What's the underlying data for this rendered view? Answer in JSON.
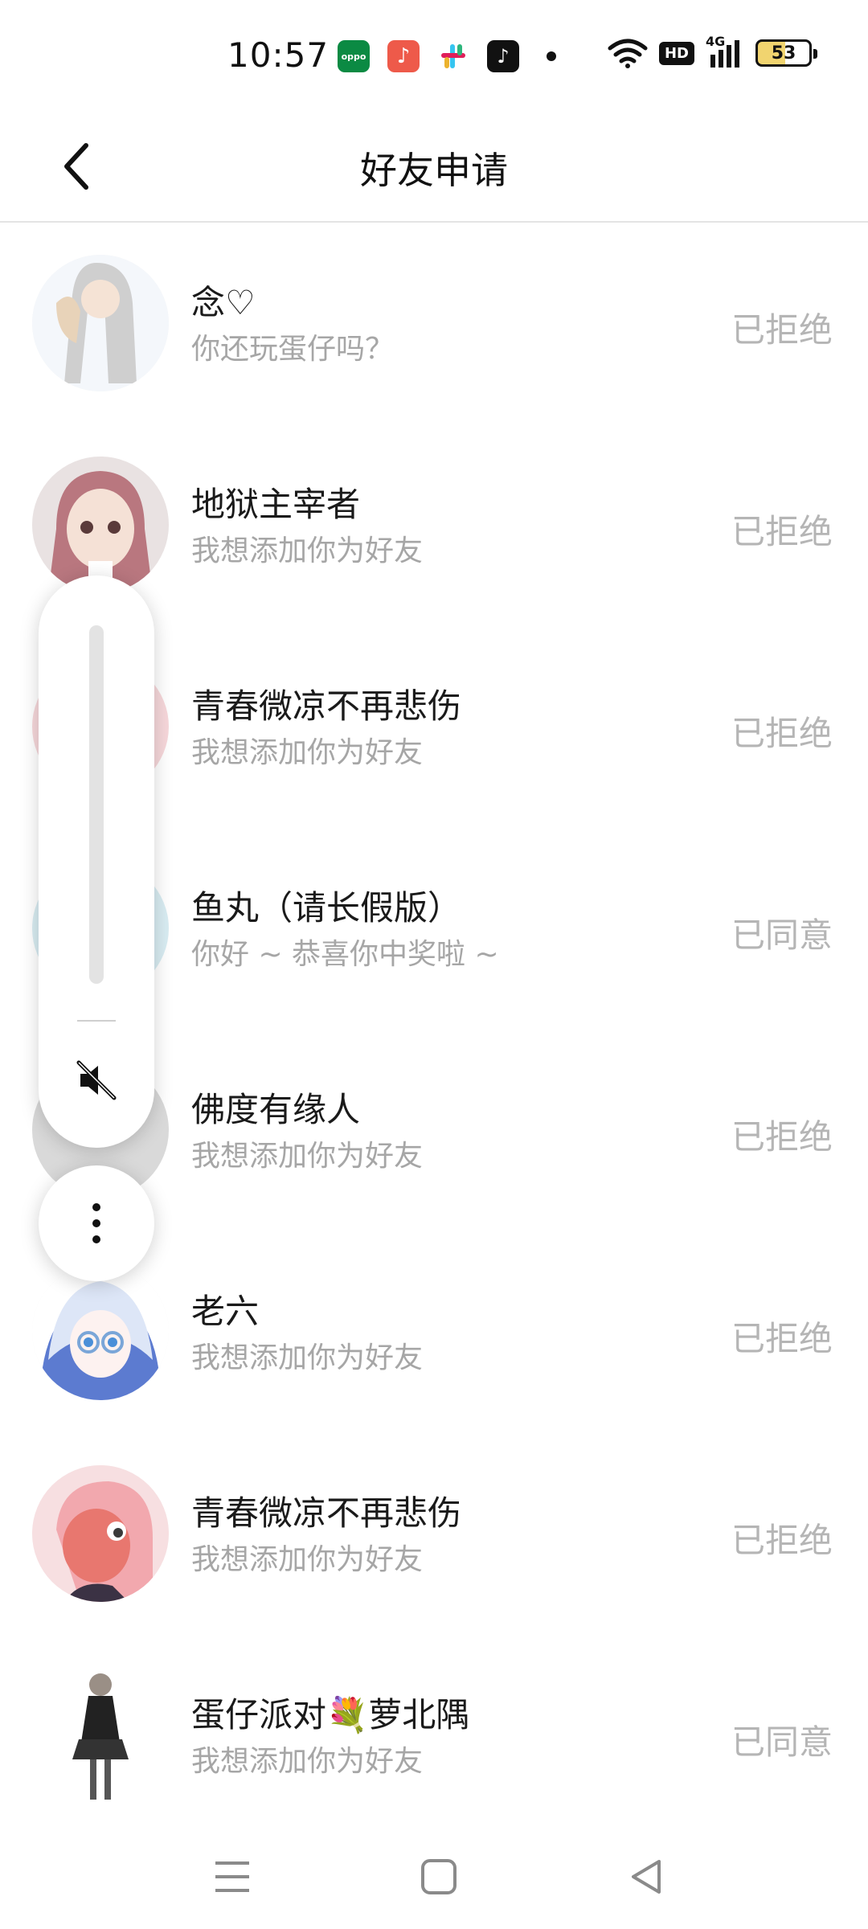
{
  "status_bar": {
    "time": "10:57",
    "apps": [
      "oppo",
      "music-note-icon",
      "slack-icon",
      "tiktok-icon"
    ],
    "hd": "HD",
    "network": "4G",
    "battery": "53"
  },
  "header": {
    "title": "好友申请",
    "back_icon": "chevron-left-icon"
  },
  "requests": [
    {
      "name": "念♡",
      "message": "你还玩蛋仔吗？",
      "status": "已拒绝",
      "avatar_color": "#eef3f8"
    },
    {
      "name": "地狱主宰者",
      "message": "我想添加你为好友",
      "status": "已拒绝",
      "avatar_color": "#c9a1a8"
    },
    {
      "name": "青春微凉不再悲伤",
      "message": "我想添加你为好友",
      "status": "已拒绝",
      "avatar_color": "#f6d7da"
    },
    {
      "name": "鱼丸（请长假版）",
      "message": "你好 ~ 恭喜你中奖啦 ~",
      "status": "已同意",
      "avatar_color": "#d8ecf2"
    },
    {
      "name": "佛度有缘人",
      "message": "我想添加你为好友",
      "status": "已拒绝",
      "avatar_color": "#d9d9d9"
    },
    {
      "name": "老六",
      "message": "我想添加你为好友",
      "status": "已拒绝",
      "avatar_color": "#5c7bd0"
    },
    {
      "name": "青春微凉不再悲伤",
      "message": "我想添加你为好友",
      "status": "已拒绝",
      "avatar_color": "#f2b4b9"
    },
    {
      "name": "蛋仔派对💐萝北隅",
      "message": "我想添加你为好友",
      "status": "已同意",
      "avatar_color": "#ffffff"
    }
  ],
  "volume_panel": {
    "mute_icon": "speaker-muted-icon",
    "more_icon": "more-vertical-icon"
  },
  "nav_bar": {
    "menu_icon": "menu-icon",
    "home_icon": "home-square-icon",
    "back_icon": "back-triangle-icon"
  }
}
